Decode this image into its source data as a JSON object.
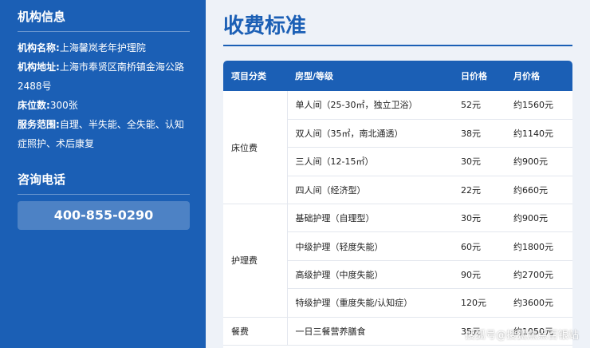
{
  "sidebar": {
    "org_heading": "机构信息",
    "name_label": "机构名称:",
    "name_value": "上海馨岚老年护理院",
    "address_label": "机构地址:",
    "address_value": "上海市奉贤区南桥镇金海公路2488号",
    "beds_label": "床位数:",
    "beds_value": "300张",
    "scope_label": "服务范围:",
    "scope_value": "自理、半失能、全失能、认知症照护、术后康复",
    "phone_heading": "咨询电话",
    "phone_number": "400-855-0290"
  },
  "main": {
    "title": "收费标准",
    "headers": [
      "项目分类",
      "房型/等级",
      "日价格",
      "月价格"
    ],
    "groups": [
      {
        "category": "床位费",
        "rows": [
          [
            "单人间（25-30㎡，独立卫浴）",
            "52元",
            "约1560元"
          ],
          [
            "双人间（35㎡，南北通透）",
            "38元",
            "约1140元"
          ],
          [
            "三人间（12-15㎡）",
            "30元",
            "约900元"
          ],
          [
            "四人间（经济型）",
            "22元",
            "约660元"
          ]
        ]
      },
      {
        "category": "护理费",
        "rows": [
          [
            "基础护理（自理型）",
            "30元",
            "约900元"
          ],
          [
            "中级护理（轻度失能）",
            "60元",
            "约1800元"
          ],
          [
            "高级护理（中度失能）",
            "90元",
            "约2700元"
          ],
          [
            "特级护理（重度失能/认知症）",
            "120元",
            "约3600元"
          ]
        ]
      },
      {
        "category": "餐费",
        "rows": [
          [
            "一日三餐营养膳食",
            "35元",
            "约1050元"
          ]
        ]
      }
    ]
  },
  "watermark": "搜狐号@搜狐焦点百银站"
}
